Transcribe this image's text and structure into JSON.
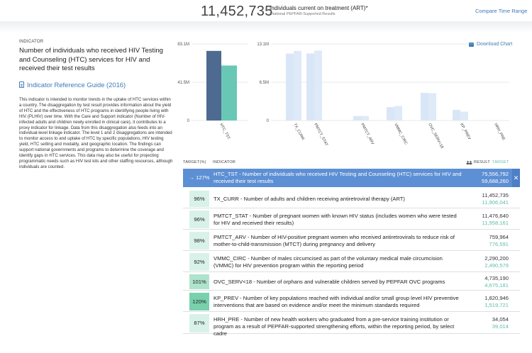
{
  "header": {
    "big_number": "11,452,735",
    "label": "Individuals current on treatment (ART)*",
    "sublabel": "*National PEPFAR-Supported Results",
    "compare_link": "Compare Time Range"
  },
  "indicator_panel": {
    "section_label": "INDICATOR",
    "title": "Number of individuals who received HIV Testing and Counseling (HTC) services for HIV and received their test results",
    "reference_guide": "Indicator Reference Guide (2016)",
    "description": "This indicator is intended to monitor trends in the uptake of HTC services within a country. The disaggregation by test result provides information about the yield of HTC and the effectiveness of HTC programs in identifying people living with HIV (PLHIV) over time. With the Care and Support indicator (Number of HIV-infected adults and children newly enrolled in clinical care), it contributes to a proxy indicator for linkage. Data from this disaggregation also feeds into an individual-level linkage indicator. The level 1 and 2 disaggregations are intended to monitor access to and uptake of HTC by specific populations, HIV testing yield, HTC setting and modality, and geographic location. The findings can support national governments and programs to determine the coverage and identify gaps in HTC services. This data may also be useful for projecting programmatic needs such as HIV test kits and other staffing resources, although individuals are counted."
  },
  "download_label": "Download Chart",
  "colors": {
    "result_dark": "#4f6a91",
    "target_teal": "#69c8b5",
    "bar_light": "#d9e6f7",
    "accent_blue": "#3d7ab8",
    "selected_row": "#5d8fd4",
    "pct_green_light": "#d9f2e9",
    "pct_green_mid": "#aee3cd",
    "pct_green_strong": "#78d0ad"
  },
  "chart_data": [
    {
      "type": "bar",
      "title": "",
      "categories": [
        "HTC_TST"
      ],
      "series": [
        {
          "name": "RESULT",
          "values": [
            75556792
          ]
        },
        {
          "name": "TARGET",
          "values": [
            59688260
          ]
        }
      ],
      "ytick_labels": [
        "83.1M",
        "41.5M",
        "0"
      ],
      "ylim": [
        0,
        83100000
      ],
      "grid": true
    },
    {
      "type": "bar",
      "title": "",
      "categories": [
        "TX_CURR",
        "PMTCT_STAT",
        "PMTCT_ARV",
        "VMMC_CIRC",
        "OVC_SERV<18",
        "KP_PREV",
        "HRH_PRE"
      ],
      "series": [
        {
          "name": "RESULT",
          "values": [
            11452735,
            11476640,
            759964,
            2290200,
            4735190,
            1820946,
            34054
          ]
        },
        {
          "name": "TARGET",
          "values": [
            11906041,
            11958161,
            776591,
            2490579,
            4675181,
            1519721,
            39014
          ]
        }
      ],
      "ytick_labels": [
        "13.1M",
        "6.5M",
        "0"
      ],
      "ylim": [
        0,
        13100000
      ],
      "grid": true
    }
  ],
  "table": {
    "col_target_pct": "TARGET(%)",
    "col_indicator": "INDICATOR",
    "col_result": "RESULT",
    "col_target": "TARGET",
    "rows": [
      {
        "pct": "127%",
        "text": "HTC_TST - Number of individuals who received HIV Testing and Counseling (HTC) services for HIV and received their test results",
        "result": "75,556,792",
        "target": "59,688,260",
        "selected": true,
        "pct_color": "#5d8fd4"
      },
      {
        "pct": "96%",
        "text": "TX_CURR - Number of adults and children receiving antiretroviral therapy (ART)",
        "result": "11,452,735",
        "target": "11,906,041",
        "selected": false,
        "pct_color": "#d9f2e9"
      },
      {
        "pct": "96%",
        "text": "PMTCT_STAT - Number of pregnant women with known HIV status (includes women who were tested for HIV and received their results)",
        "result": "11,476,640",
        "target": "11,958,161",
        "selected": false,
        "pct_color": "#d9f2e9"
      },
      {
        "pct": "98%",
        "text": "PMTCT_ARV - Number of HIV-positive pregnant women who received antiretrovirals to reduce risk of mother-to-child-transmission (MTCT) during pregnancy and delivery",
        "result": "759,964",
        "target": "776,591",
        "selected": false,
        "pct_color": "#d9f2e9"
      },
      {
        "pct": "92%",
        "text": "VMMC_CIRC - Number of males circumcised as part of the voluntary medical male circumcision (VMMC) for HIV prevention program within the reporting period",
        "result": "2,290,200",
        "target": "2,490,579",
        "selected": false,
        "pct_color": "#d9f2e9"
      },
      {
        "pct": "101%",
        "text": "OVC_SERV<18 - Number of orphans and vulnerable children served by PEPFAR OVC programs",
        "result": "4,735,190",
        "target": "4,675,181",
        "selected": false,
        "pct_color": "#aee3cd"
      },
      {
        "pct": "120%",
        "text": "KP_PREV - Number of key populations reached with individual and/or small group level HIV preventive interventions that are based on evidence and/or meet the minimum standards required",
        "result": "1,820,946",
        "target": "1,519,721",
        "selected": false,
        "pct_color": "#78d0ad"
      },
      {
        "pct": "87%",
        "text": "HRH_PRE - Number of new health workers who graduated from a pre-service training institution or program as a result of PEPFAR-supported strengthening efforts, within the reporting period, by select cadre",
        "result": "34,054",
        "target": "39,014",
        "selected": false,
        "pct_color": "#d9f2e9"
      }
    ]
  }
}
